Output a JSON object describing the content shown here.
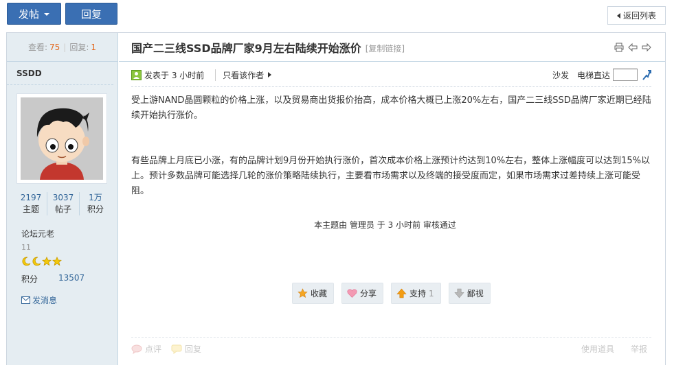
{
  "toolbar": {
    "post_label": "发帖",
    "reply_label": "回复",
    "back_label": "返回列表"
  },
  "side": {
    "views_label": "查看:",
    "views_value": "75",
    "replies_label": "回复:",
    "replies_value": "1",
    "author": "SSDD",
    "stats": [
      {
        "value": "2197",
        "label": "主题"
      },
      {
        "value": "3037",
        "label": "帖子"
      },
      {
        "value": "1万",
        "label": "积分"
      }
    ],
    "rank": "论坛元老",
    "level": "11",
    "score_label": "积分",
    "score_value": "13507",
    "message_label": "发消息"
  },
  "post": {
    "title": "国产二三线SSD品牌厂家9月左右陆续开始涨价",
    "copy_link": "[复制链接]",
    "posted": "发表于 3 小时前",
    "only_author": "只看该作者",
    "sofa": "沙发",
    "elevator": "电梯直达",
    "paragraphs": [
      "受上游NAND晶圆颗粒的价格上涨，以及贸易商出货报价抬高，成本价格大概已上涨20%左右，国产二三线SSD品牌厂家近期已经陆续开始执行涨价。",
      "有些品牌上月底已小涨，有的品牌计划9月份开始执行涨价，首次成本价格上涨预计约达到10%左右，整体上涨幅度可以达到15%以上。预计多数品牌可能选择几轮的涨价策略陆续执行，主要看市场需求以及终端的接受度而定，如果市场需求过差持续上涨可能受阻。"
    ],
    "audit": "本主题由 管理员 于 3 小时前 审核通过",
    "actions": {
      "favorite": "收藏",
      "share": "分享",
      "support": "支持",
      "support_count": "1",
      "despise": "鄙视"
    },
    "bottom": {
      "rate": "点评",
      "reply": "回复",
      "use_tool": "使用道具",
      "report": "举报"
    }
  },
  "colors": {
    "primary_button": "#3a6fb3",
    "link": "#336699",
    "count_highlight": "#e3661b",
    "sidebar_bg": "#e5edf2"
  }
}
